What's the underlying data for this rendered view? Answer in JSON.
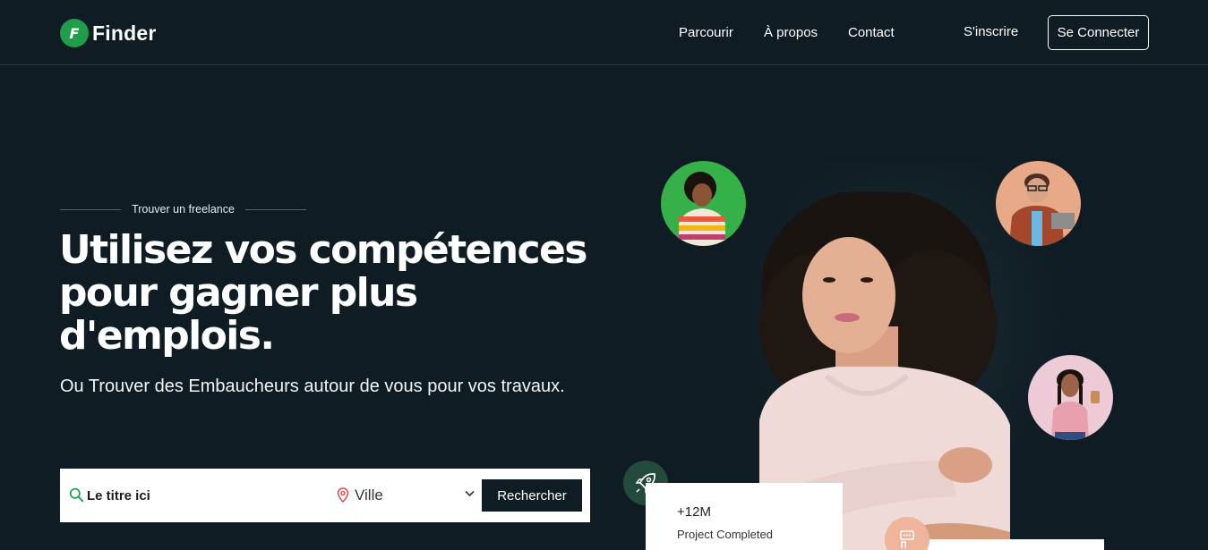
{
  "brand": {
    "logo_letter": "F",
    "name": "Finder",
    "accent": "#1f9d4a"
  },
  "nav": {
    "links": [
      "Parcourir",
      "À propos",
      "Contact"
    ],
    "signup": "S'inscrire",
    "login": "Se Connecter"
  },
  "hero": {
    "eyebrow": "Trouver un freelance",
    "headline": "Utilisez vos compétences pour gagner plus d'emplois.",
    "subtitle": "Ou Trouver des Embaucheurs autour de vous pour vos travaux."
  },
  "search": {
    "title_placeholder": "Le titre ici",
    "city_value": "Ville",
    "button": "Rechercher"
  },
  "stats": {
    "value": "+12M",
    "label": "Project Completed"
  },
  "colors": {
    "background": "#0f1c23",
    "white": "#ffffff"
  }
}
